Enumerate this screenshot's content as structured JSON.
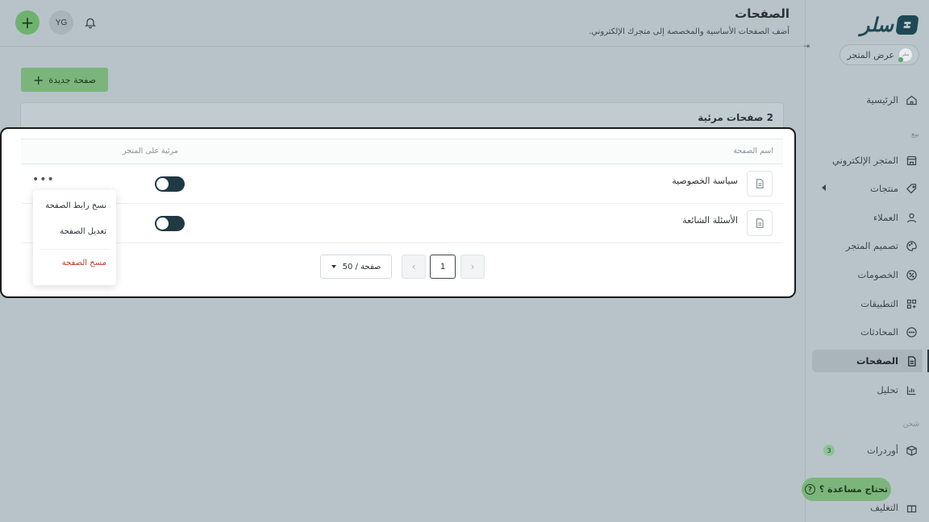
{
  "brand": {
    "logo_text": "سلر"
  },
  "store_button": {
    "label": "عرض المتجر",
    "avatar_text": "سلر"
  },
  "sidebar": {
    "items": [
      {
        "label": "الرئيسية",
        "icon": "home-icon"
      },
      {
        "label": "المتجر الإلكتروني",
        "icon": "store-icon"
      },
      {
        "label": "منتجات",
        "icon": "tag-icon"
      },
      {
        "label": "العملاء",
        "icon": "user-icon"
      },
      {
        "label": "تصميم المتجر",
        "icon": "palette-icon"
      },
      {
        "label": "الخصومات",
        "icon": "discount-icon"
      },
      {
        "label": "التطبيقات",
        "icon": "apps-icon"
      },
      {
        "label": "المحادثات",
        "icon": "chat-icon"
      },
      {
        "label": "الصفحات",
        "icon": "page-icon"
      },
      {
        "label": "تحليل",
        "icon": "chart-icon"
      },
      {
        "label": "أوردرات",
        "icon": "box-icon",
        "badge": "3"
      },
      {
        "label": "التغليف",
        "icon": "package-icon"
      }
    ],
    "sections": {
      "sell": "بيع",
      "ship": "شحن"
    },
    "active": "الصفحات"
  },
  "header": {
    "title": "الصفحات",
    "subtitle": "أضف الصفحات الأساسية والمخصصة إلى متجرك الإلكتروني.",
    "avatar_initials": "YG",
    "plus_label": "+"
  },
  "actions": {
    "new_page_label": "صفحة جديدة"
  },
  "card": {
    "title": "2 صفحات مرئية",
    "columns": {
      "name": "اسم الصفحة",
      "visible": "مرئية على المتجر"
    },
    "rows": [
      {
        "name": "سياسة الخصوصية",
        "visible": true
      },
      {
        "name": "الأسئلة الشائعة",
        "visible": true
      }
    ],
    "row_menu_glyph": "•••"
  },
  "dropdown": {
    "items": [
      {
        "label": "نسخ رابط الصفحة"
      },
      {
        "label": "تعديل الصفحة"
      },
      {
        "label": "مسح الصفحة"
      }
    ]
  },
  "pagination": {
    "page_size_label": "50 / صفحة",
    "current_page": "1",
    "prev_glyph": "‹",
    "next_glyph": "›"
  },
  "help": {
    "label": "تحتاج مساعدة ؟",
    "icon_glyph": "?"
  },
  "colors": {
    "accent_green": "#7cb57c",
    "toggle_on": "#1f3a43",
    "danger": "#c0392b",
    "brand": "#1e4954"
  }
}
